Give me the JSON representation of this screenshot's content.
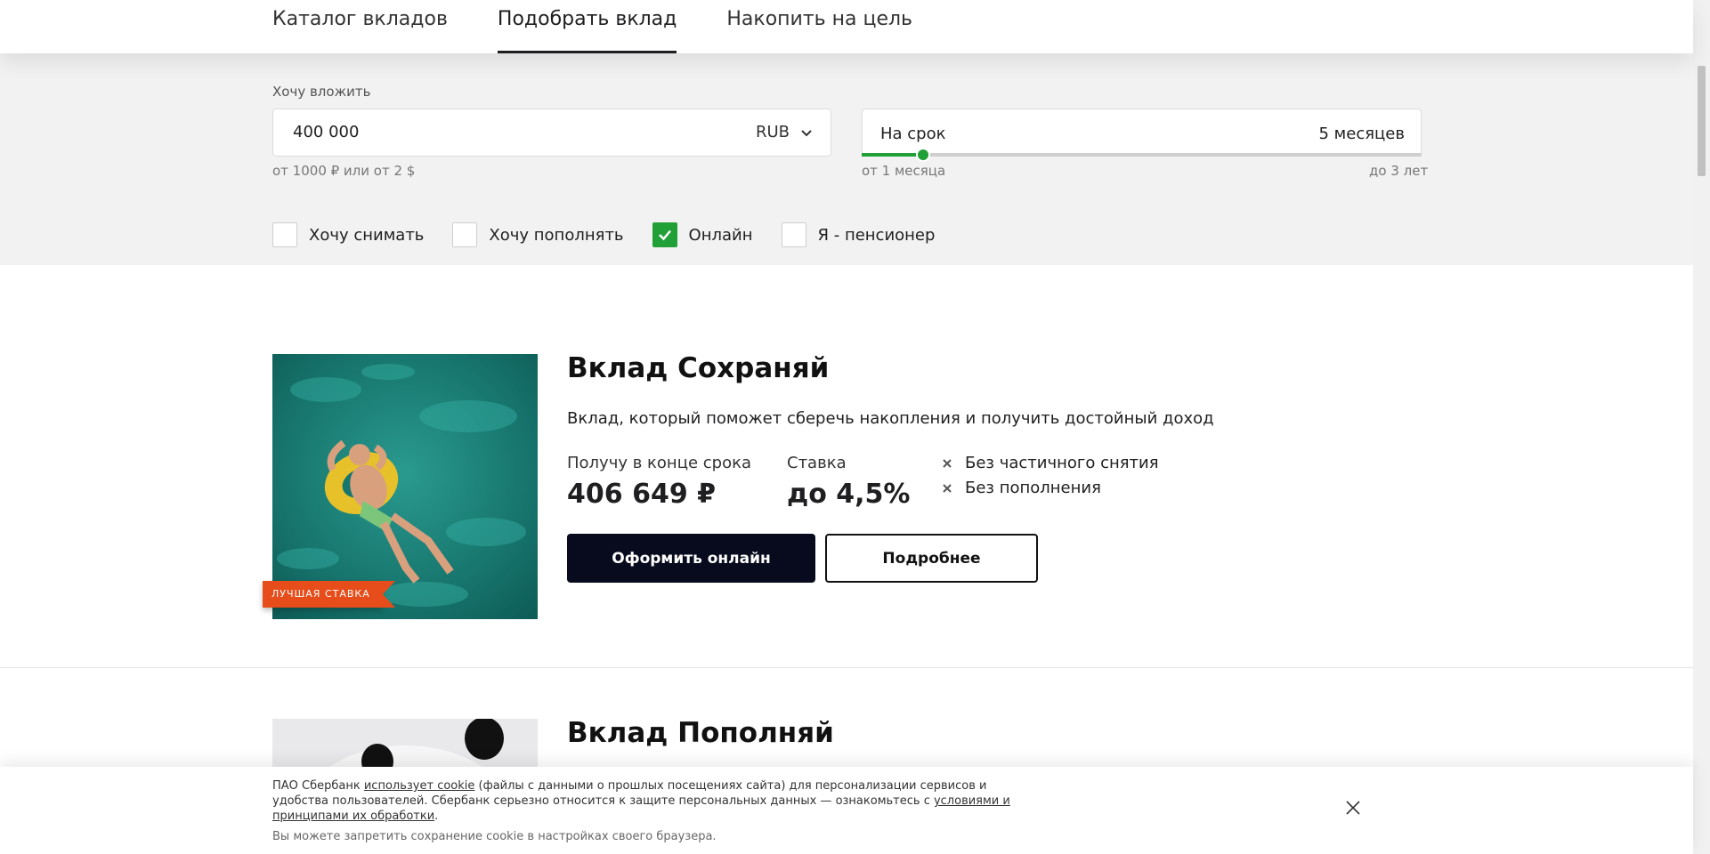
{
  "tabs": [
    {
      "label": "Каталог вкладов"
    },
    {
      "label": "Подобрать вклад"
    },
    {
      "label": "Накопить на цель"
    }
  ],
  "filters": {
    "amount_label": "Хочу вложить",
    "amount_value": "400 000",
    "currency": "RUB",
    "amount_hint": "от 1000 ₽ или от 2 $",
    "term_label": "На срок",
    "term_value": "5 месяцев",
    "term_min": "от 1 месяца",
    "term_max": "до 3 лет",
    "term_slider_fraction": 0.11,
    "checkboxes": [
      {
        "label": "Хочу снимать",
        "checked": false
      },
      {
        "label": "Хочу пополнять",
        "checked": false
      },
      {
        "label": "Онлайн",
        "checked": true
      },
      {
        "label": "Я - пенсионер",
        "checked": false
      }
    ]
  },
  "deposits": [
    {
      "title": "Вклад Сохраняй",
      "description": "Вклад, который поможет сберечь накопления и получить достойный доход",
      "badge": "ЛУЧШАЯ СТАВКА",
      "payout_label": "Получу в конце срока",
      "payout_value": "406 649 ₽",
      "rate_label": "Ставка",
      "rate_value": "до 4,5%",
      "features": [
        "Без частичного снятия",
        "Без пополнения"
      ],
      "primary_button": "Оформить онлайн",
      "secondary_button": "Подробнее"
    },
    {
      "title": "Вклад Пополняй"
    }
  ],
  "cookie": {
    "text_1": "ПАО Сбербанк ",
    "link_1": "использует cookie",
    "text_2": " (файлы с данными о прошлых посещениях сайта) для персонализации сервисов и удобства пользователей. Сбербанк серьезно относится к защите персональных данных — ознакомьтесь с ",
    "link_2": "условиями и принципами их обработки",
    "text_3": ".",
    "line_2": "Вы можете запретить сохранение cookie в настройках своего браузера."
  },
  "colors": {
    "accent_green": "#21a038",
    "badge_orange": "#e64d1a",
    "primary_button": "#080a1d",
    "filter_bg": "#f2f2f2"
  }
}
